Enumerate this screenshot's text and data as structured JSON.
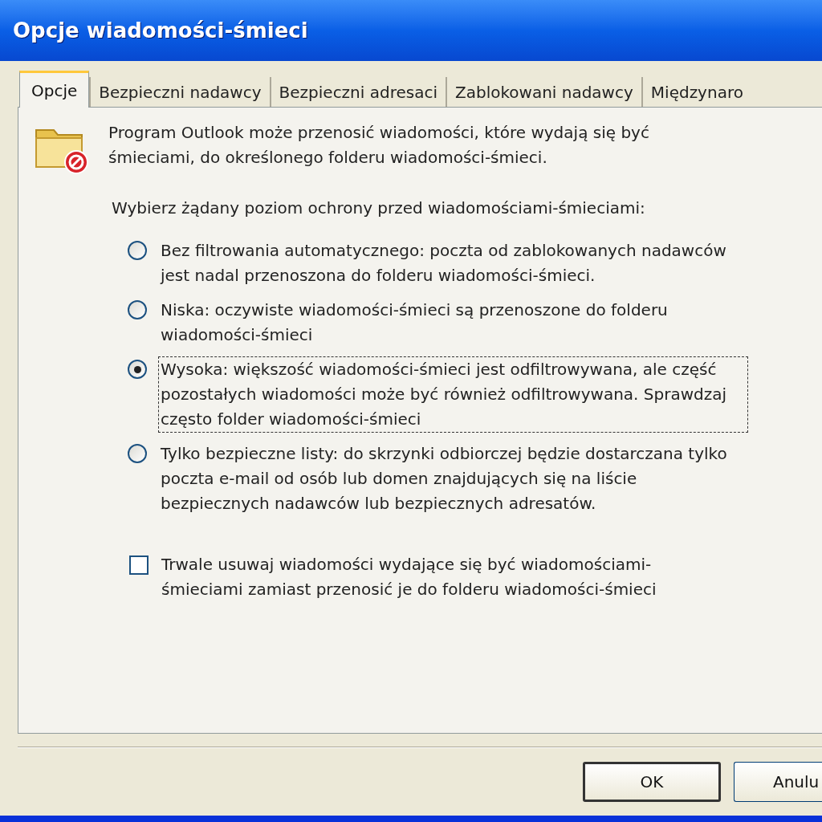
{
  "window": {
    "title": "Opcje wiadomości-śmieci"
  },
  "tabs": [
    {
      "label": "Opcje",
      "selected": true
    },
    {
      "label": "Bezpieczni nadawcy",
      "selected": false
    },
    {
      "label": "Bezpieczni adresaci",
      "selected": false
    },
    {
      "label": "Zablokowani nadawcy",
      "selected": false
    },
    {
      "label": "Międzynaro",
      "selected": false
    }
  ],
  "intro": "Program Outlook może przenosić wiadomości, które wydają się być śmieciami, do określonego folderu wiadomości-śmieci.",
  "prompt": "Wybierz żądany poziom ochrony przed wiadomościami-śmieciami:",
  "levels": [
    {
      "label": "Bez filtrowania automatycznego: poczta od zablokowanych nadawców jest nadal przenoszona do folderu wiadomości-śmieci.",
      "selected": false
    },
    {
      "label": "Niska: oczywiste wiadomości-śmieci są przenoszone do folderu wiadomości-śmieci",
      "selected": false
    },
    {
      "label": "Wysoka: większość wiadomości-śmieci jest odfiltrowywana, ale część pozostałych wiadomości może być również odfiltrowywana. Sprawdzaj często folder wiadomości-śmieci",
      "selected": true
    },
    {
      "label": "Tylko bezpieczne listy: do skrzynki odbiorczej będzie dostarczana tylko poczta e-mail od osób lub domen znajdujących się na liście bezpiecznych nadawców lub bezpiecznych adresatów.",
      "selected": false
    }
  ],
  "delete_option": {
    "label": "Trwale usuwaj wiadomości wydające się być wiadomościami-śmieciami zamiast przenosić je do folderu wiadomości-śmieci",
    "checked": false
  },
  "buttons": [
    {
      "label": "OK",
      "default": true
    },
    {
      "label": "Anulu",
      "default": false
    }
  ]
}
